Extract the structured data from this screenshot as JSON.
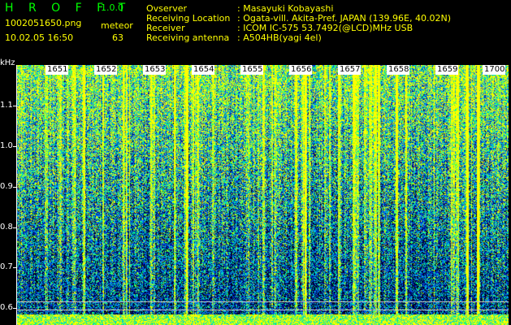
{
  "header": {
    "app_title": "H R O F F T",
    "version": "1.0.0",
    "filename": "1002051650.png",
    "meteor_label": "meteor",
    "datetime": "10.02.05 16:50",
    "meteor_count": "63"
  },
  "info": [
    {
      "key": "Ovserver",
      "value": ": Masayuki Kobayashi"
    },
    {
      "key": "Receiving Location",
      "value": ": Ogata-vill. Akita-Pref. JAPAN (139.96E, 40.02N)"
    },
    {
      "key": "Receiver",
      "value": ": ICOM IC-575 53.7492(@LCD)MHz USB"
    },
    {
      "key": "Receiving antenna",
      "value": ": A504HB(yagi 4el)"
    }
  ],
  "spectrogram": {
    "y_unit": "kHz",
    "y_ticks": [
      "1.1",
      "1.0",
      "0.9",
      "0.8",
      "0.7",
      "0.6"
    ],
    "time_labels": [
      "1651",
      "1652",
      "1653",
      "1654",
      "1655",
      "1656",
      "1657",
      "1658",
      "1659",
      "1700"
    ],
    "colors": {
      "background": "#000018",
      "low": "#0000a0",
      "mid": "#00a0ff",
      "high": "#00ff80",
      "peak": "#ffff00"
    }
  }
}
